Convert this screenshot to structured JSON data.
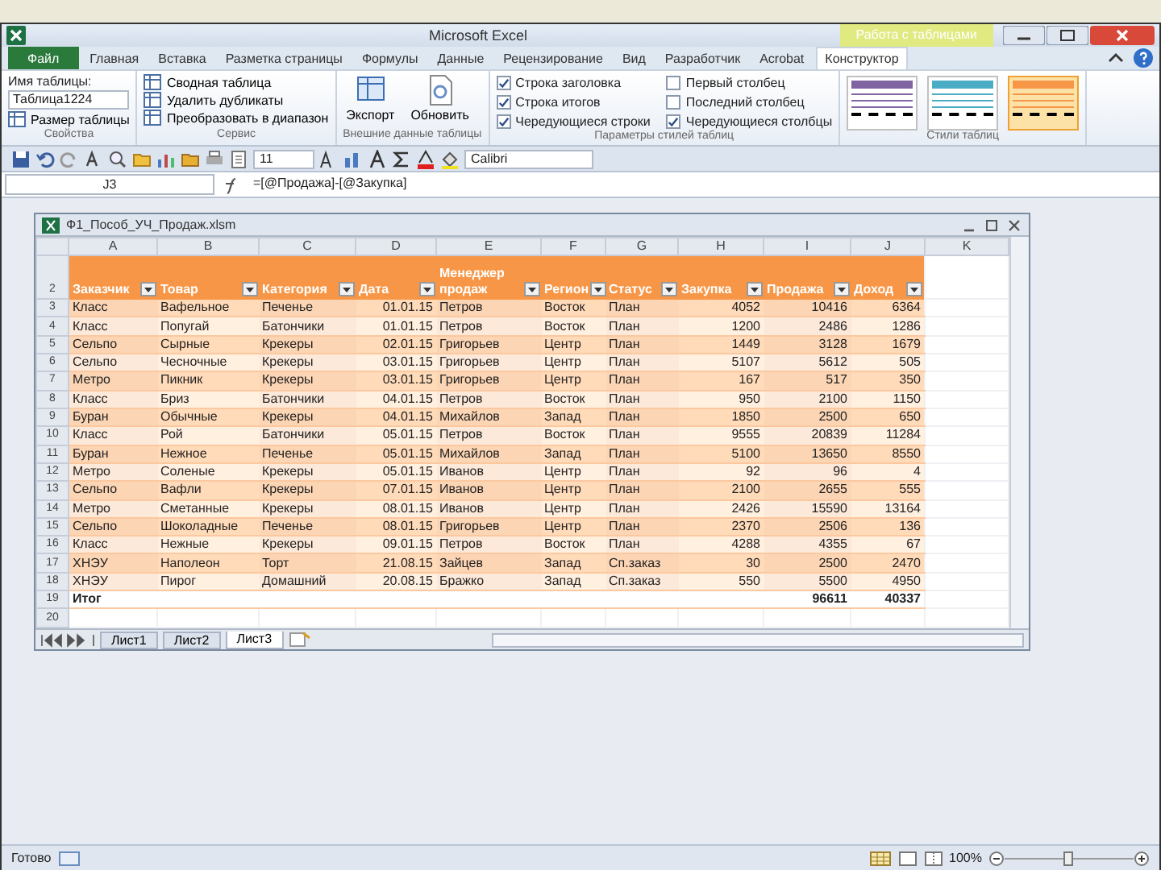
{
  "window": {
    "title": "Microsoft Excel",
    "context_tab": "Работа с таблицами"
  },
  "tabs": [
    {
      "label": "Файл",
      "kind": "file",
      "selected": false
    },
    {
      "label": "Главная",
      "kind": "tab",
      "selected": false
    },
    {
      "label": "Вставка",
      "kind": "tab",
      "selected": false
    },
    {
      "label": "Разметка страницы",
      "kind": "tab",
      "selected": false
    },
    {
      "label": "Формулы",
      "kind": "tab",
      "selected": false
    },
    {
      "label": "Данные",
      "kind": "tab",
      "selected": false
    },
    {
      "label": "Рецензирование",
      "kind": "tab",
      "selected": false
    },
    {
      "label": "Вид",
      "kind": "tab",
      "selected": false
    },
    {
      "label": "Разработчик",
      "kind": "tab",
      "selected": false
    },
    {
      "label": "Acrobat",
      "kind": "tab",
      "selected": false
    },
    {
      "label": "Конструктор",
      "kind": "tab",
      "selected": true
    }
  ],
  "ribbon": {
    "groups": [
      {
        "label": "Свойства",
        "items": [
          {
            "kind": "text",
            "label": "Имя таблицы:"
          },
          {
            "kind": "field",
            "value": "Таблица1224"
          },
          {
            "kind": "button",
            "label": "Размер таблицы"
          }
        ]
      },
      {
        "label": "Сервис",
        "items": [
          {
            "kind": "button",
            "label": "Сводная таблица"
          },
          {
            "kind": "button",
            "label": "Удалить дубликаты"
          },
          {
            "kind": "button",
            "label": "Преобразовать в диапазон"
          }
        ]
      },
      {
        "label": "Внешние данные таблицы",
        "items": [
          {
            "kind": "big",
            "label": "Экспорт"
          },
          {
            "kind": "big",
            "label": "Обновить"
          }
        ]
      },
      {
        "label": "Параметры стилей таблиц",
        "items": [
          {
            "kind": "checkbox",
            "label": "Строка заголовка",
            "checked": true
          },
          {
            "kind": "checkbox",
            "label": "Строка итогов",
            "checked": true
          },
          {
            "kind": "checkbox",
            "label": "Чередующиеся строки",
            "checked": true
          },
          {
            "kind": "checkbox",
            "label": "Первый столбец",
            "checked": false
          },
          {
            "kind": "checkbox",
            "label": "Последний столбец",
            "checked": false
          },
          {
            "kind": "checkbox",
            "label": "Чередующиеся столбцы",
            "checked": true
          }
        ]
      },
      {
        "label": "Стили таблиц",
        "items": [
          {
            "kind": "swatch",
            "color": "#8064a2",
            "selected": false
          },
          {
            "kind": "swatch",
            "color": "#4bacc6",
            "selected": false
          },
          {
            "kind": "swatch",
            "color": "#f79646",
            "selected": true
          }
        ]
      }
    ]
  },
  "toolbar": {
    "font_size": "11",
    "font": "Calibri"
  },
  "formula_bar": {
    "name_box": "J3",
    "formula": "=[@Продажа]-[@Закупка]"
  },
  "workbook": {
    "title": "Ф1_Пособ_УЧ_Продаж.xlsm",
    "columns": [
      "A",
      "B",
      "C",
      "D",
      "E",
      "F",
      "G",
      "H",
      "I",
      "J",
      "K"
    ],
    "header_row": {
      "num": "2",
      "cells": [
        "Заказчик",
        "Товар",
        "Категория",
        "Дата",
        "Менеджер продаж",
        "Регион",
        "Статус",
        "Закупка",
        "Продажа",
        "Доход"
      ]
    },
    "rows": [
      {
        "num": "3",
        "cells": [
          "Класс",
          "Вафельное",
          "Печенье",
          "01.01.15",
          "Петров",
          "Восток",
          "План",
          "4052",
          "10416",
          "6364"
        ]
      },
      {
        "num": "4",
        "cells": [
          "Класс",
          "Попугай",
          "Батончики",
          "01.01.15",
          "Петров",
          "Восток",
          "План",
          "1200",
          "2486",
          "1286"
        ]
      },
      {
        "num": "5",
        "cells": [
          "Сельпо",
          "Сырные",
          "Крекеры",
          "02.01.15",
          "Григорьев",
          "Центр",
          "План",
          "1449",
          "3128",
          "1679"
        ]
      },
      {
        "num": "6",
        "cells": [
          "Сельпо",
          "Чесночные",
          "Крекеры",
          "03.01.15",
          "Григорьев",
          "Центр",
          "План",
          "5107",
          "5612",
          "505"
        ]
      },
      {
        "num": "7",
        "cells": [
          "Метро",
          "Пикник",
          "Крекеры",
          "03.01.15",
          "Григорьев",
          "Центр",
          "План",
          "167",
          "517",
          "350"
        ]
      },
      {
        "num": "8",
        "cells": [
          "Класс",
          "Бриз",
          "Батончики",
          "04.01.15",
          "Петров",
          "Восток",
          "План",
          "950",
          "2100",
          "1150"
        ]
      },
      {
        "num": "9",
        "cells": [
          "Буран",
          "Обычные",
          "Крекеры",
          "04.01.15",
          "Михайлов",
          "Запад",
          "План",
          "1850",
          "2500",
          "650"
        ]
      },
      {
        "num": "10",
        "cells": [
          "Класс",
          "Рой",
          "Батончики",
          "05.01.15",
          "Петров",
          "Восток",
          "План",
          "9555",
          "20839",
          "11284"
        ]
      },
      {
        "num": "11",
        "cells": [
          "Буран",
          "Нежное",
          "Печенье",
          "05.01.15",
          "Михайлов",
          "Запад",
          "План",
          "5100",
          "13650",
          "8550"
        ]
      },
      {
        "num": "12",
        "cells": [
          "Метро",
          "Соленые",
          "Крекеры",
          "05.01.15",
          "Иванов",
          "Центр",
          "План",
          "92",
          "96",
          "4"
        ]
      },
      {
        "num": "13",
        "cells": [
          "Сельпо",
          "Вафли",
          "Крекеры",
          "07.01.15",
          "Иванов",
          "Центр",
          "План",
          "2100",
          "2655",
          "555"
        ]
      },
      {
        "num": "14",
        "cells": [
          "Метро",
          "Сметанные",
          "Крекеры",
          "08.01.15",
          "Иванов",
          "Центр",
          "План",
          "2426",
          "15590",
          "13164"
        ]
      },
      {
        "num": "15",
        "cells": [
          "Сельпо",
          "Шоколадные",
          "Печенье",
          "08.01.15",
          "Григорьев",
          "Центр",
          "План",
          "2370",
          "2506",
          "136"
        ]
      },
      {
        "num": "16",
        "cells": [
          "Класс",
          "Нежные",
          "Крекеры",
          "09.01.15",
          "Петров",
          "Восток",
          "План",
          "4288",
          "4355",
          "67"
        ]
      },
      {
        "num": "17",
        "cells": [
          "ХНЭУ",
          "Наполеон",
          "Торт",
          "21.08.15",
          "Зайцев",
          "Запад",
          "Сп.заказ",
          "30",
          "2500",
          "2470"
        ]
      },
      {
        "num": "18",
        "cells": [
          "ХНЭУ",
          "Пирог",
          "Домашний",
          "20.08.15",
          "Бражко",
          "Запад",
          "Сп.заказ",
          "550",
          "5500",
          "4950"
        ]
      }
    ],
    "total_row": {
      "num": "19",
      "label": "Итог",
      "sales": "96611",
      "income": "40337"
    },
    "empty_rows": [
      "20"
    ],
    "sheets": [
      {
        "label": "Лист1",
        "selected": false
      },
      {
        "label": "Лист2",
        "selected": false
      },
      {
        "label": "Лист3",
        "selected": true
      }
    ]
  },
  "status_bar": {
    "status": "Готово",
    "zoom": "100%"
  }
}
